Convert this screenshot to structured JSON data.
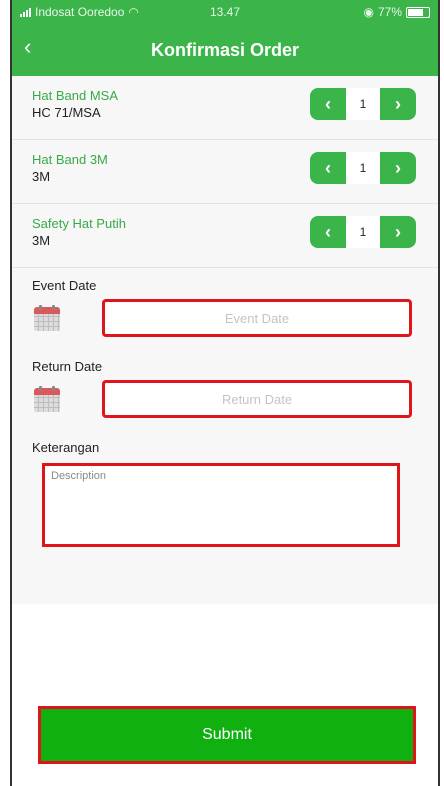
{
  "status_bar": {
    "carrier": "Indosat Ooredoo",
    "time": "13.47",
    "battery": "77%"
  },
  "header": {
    "title": "Konfirmasi Order",
    "back_icon": "chevron-left-icon"
  },
  "items": [
    {
      "name": "Hat Band MSA",
      "code": "HC 71/MSA",
      "qty": "1"
    },
    {
      "name": "Hat Band 3M",
      "code": "3M",
      "qty": "1"
    },
    {
      "name": "Safety Hat Putih",
      "code": "3M",
      "qty": "1"
    }
  ],
  "stepper": {
    "decrement": "‹",
    "increment": "›"
  },
  "event_date": {
    "label": "Event Date",
    "placeholder": "Event Date"
  },
  "return_date": {
    "label": "Return Date",
    "placeholder": "Return Date"
  },
  "keterangan": {
    "label": "Keterangan",
    "placeholder": "Description"
  },
  "submit_label": "Submit",
  "colors": {
    "primary": "#3bb54a",
    "highlight": "#e0141b",
    "submit": "#10b011"
  }
}
